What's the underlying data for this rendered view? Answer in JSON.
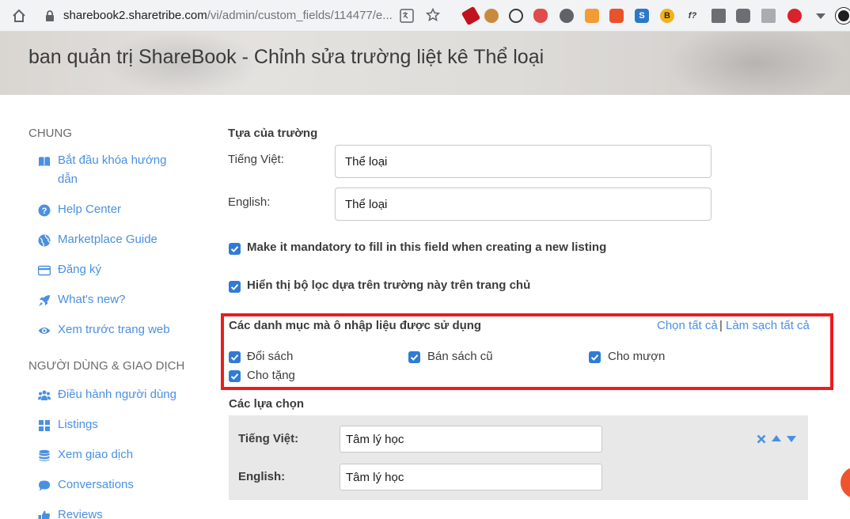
{
  "browser": {
    "url_host": "sharebook2.sharetribe.com",
    "url_path": "/vi/admin/custom_fields/114477/e..."
  },
  "header": {
    "title": "ban quản trị ShareBook - Chỉnh sửa trường liệt kê Thể loại"
  },
  "sidebar": {
    "section_general": "CHUNG",
    "general_items": [
      {
        "label": "Bắt đầu khóa hướng dẫn",
        "icon": "book-icon"
      },
      {
        "label": "Help Center",
        "icon": "question-circle-icon"
      },
      {
        "label": "Marketplace Guide",
        "icon": "globe-icon"
      },
      {
        "label": "Đăng ký",
        "icon": "credit-card-icon"
      },
      {
        "label": "What's new?",
        "icon": "rocket-icon"
      },
      {
        "label": "Xem trước trang web",
        "icon": "eye-icon"
      }
    ],
    "section_users": "NGƯỜI DÙNG & GIAO DỊCH",
    "user_items": [
      {
        "label": "Điều hành người dùng",
        "icon": "users-icon"
      },
      {
        "label": "Listings",
        "icon": "grid-icon"
      },
      {
        "label": "Xem giao dịch",
        "icon": "database-icon"
      },
      {
        "label": "Conversations",
        "icon": "chat-icon"
      },
      {
        "label": "Reviews",
        "icon": "thumbs-up-icon"
      }
    ]
  },
  "form": {
    "field_title_label": "Tựa của trường",
    "lang_vi_label": "Tiếng Việt:",
    "lang_vi_value": "Thể loại",
    "lang_en_label": "English:",
    "lang_en_value": "Thể loại",
    "mandatory_label": "Make it mandatory to fill in this field when creating a new listing",
    "mandatory_checked": true,
    "filter_label": "Hiển thị bộ lọc dựa trên trường này trên trang chủ",
    "filter_checked": true,
    "categories_heading": "Các danh mục mà ô nhập liệu được sử dụng",
    "select_all": "Chọn tất cả",
    "separator": "|",
    "clear_all": "Làm sạch tất cả",
    "categories": [
      {
        "label": "Đổi sách",
        "checked": true
      },
      {
        "label": "Bán sách cũ",
        "checked": true
      },
      {
        "label": "Cho mượn",
        "checked": true
      },
      {
        "label": "Cho tặng",
        "checked": true
      }
    ],
    "options_heading": "Các lựa chọn",
    "option": {
      "vi_label": "Tiếng Việt:",
      "vi_value": "Tâm lý học",
      "en_label": "English:",
      "en_value": "Tâm lý học"
    }
  },
  "colors": {
    "link": "#4a90e2",
    "checkbox": "#2f7bd6",
    "highlight_box": "#ee1c1c"
  }
}
